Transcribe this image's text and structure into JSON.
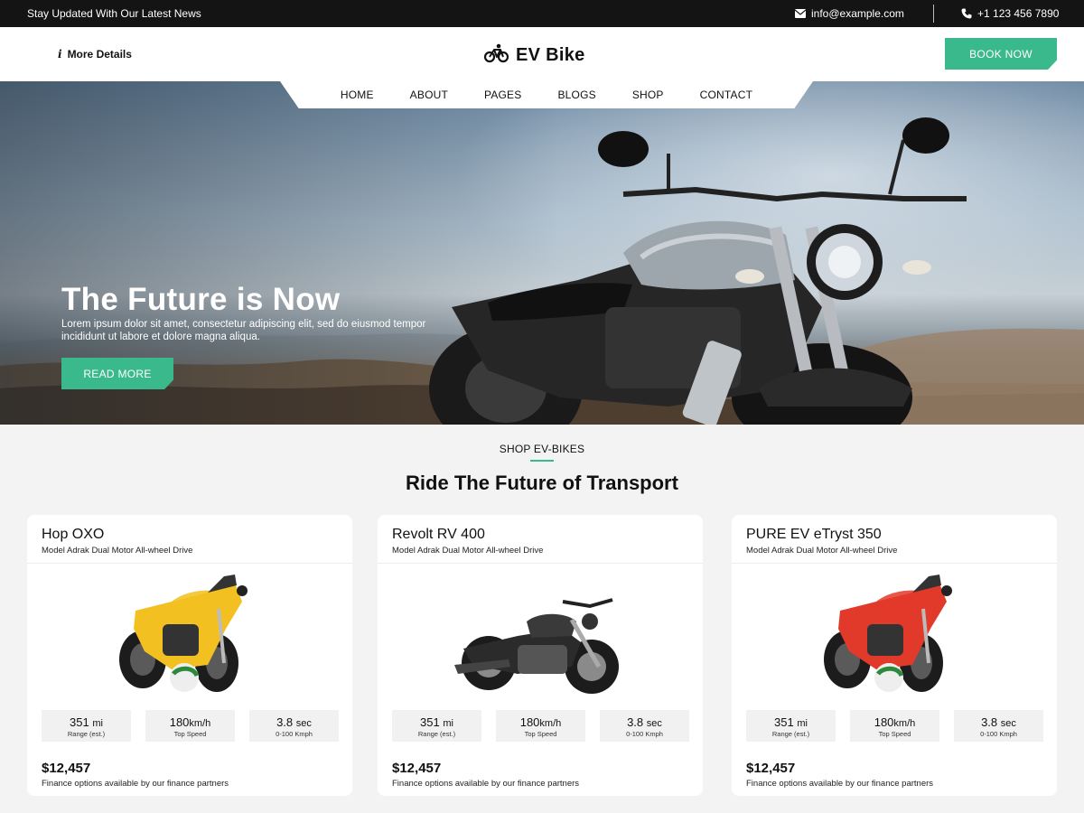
{
  "topbar": {
    "news": "Stay Updated With Our Latest News",
    "email": "info@example.com",
    "phone": "+1 123 456 7890"
  },
  "header": {
    "more_details": "More Details",
    "logo_text": "EV Bike",
    "book_now": "BOOK NOW"
  },
  "nav": {
    "items": [
      "HOME",
      "ABOUT",
      "PAGES",
      "BLOGS",
      "SHOP",
      "CONTACT"
    ]
  },
  "hero": {
    "title": "The Future is Now",
    "subtitle": "Lorem ipsum dolor sit amet, consectetur adipiscing elit, sed do eiusmod tempor incididunt ut labore et dolore magna aliqua.",
    "button": "READ MORE"
  },
  "section": {
    "eyebrow": "SHOP EV-BIKES",
    "title": "Ride The Future of Transport"
  },
  "products": [
    {
      "name": "Hop OXO",
      "model": "Model Adrak Dual Motor All-wheel Drive",
      "bike_color": "#f2c020",
      "specs": [
        {
          "value": "351",
          "unit": "mi",
          "label": "Range (est.)"
        },
        {
          "value": "180",
          "unit": "km/h",
          "label": "Top Speed"
        },
        {
          "value": "3.8",
          "unit": "sec",
          "label": "0-100 Kmph"
        }
      ],
      "price": "$12,457",
      "finance": "Finance options available by our finance partners"
    },
    {
      "name": "Revolt RV 400",
      "model": "Model Adrak Dual Motor All-wheel Drive",
      "bike_color": "#2b2b2b",
      "specs": [
        {
          "value": "351",
          "unit": "mi",
          "label": "Range (est.)"
        },
        {
          "value": "180",
          "unit": "km/h",
          "label": "Top Speed"
        },
        {
          "value": "3.8",
          "unit": "sec",
          "label": "0-100 Kmph"
        }
      ],
      "price": "$12,457",
      "finance": "Finance options available by our finance partners"
    },
    {
      "name": "PURE EV eTryst 350",
      "model": "Model Adrak Dual Motor All-wheel Drive",
      "bike_color": "#e23a2a",
      "specs": [
        {
          "value": "351",
          "unit": "mi",
          "label": "Range (est.)"
        },
        {
          "value": "180",
          "unit": "km/h",
          "label": "Top Speed"
        },
        {
          "value": "3.8",
          "unit": "sec",
          "label": "0-100 Kmph"
        }
      ],
      "price": "$12,457",
      "finance": "Finance options available by our finance partners"
    }
  ],
  "colors": {
    "accent": "#3ab98c",
    "topbar": "#141414"
  }
}
